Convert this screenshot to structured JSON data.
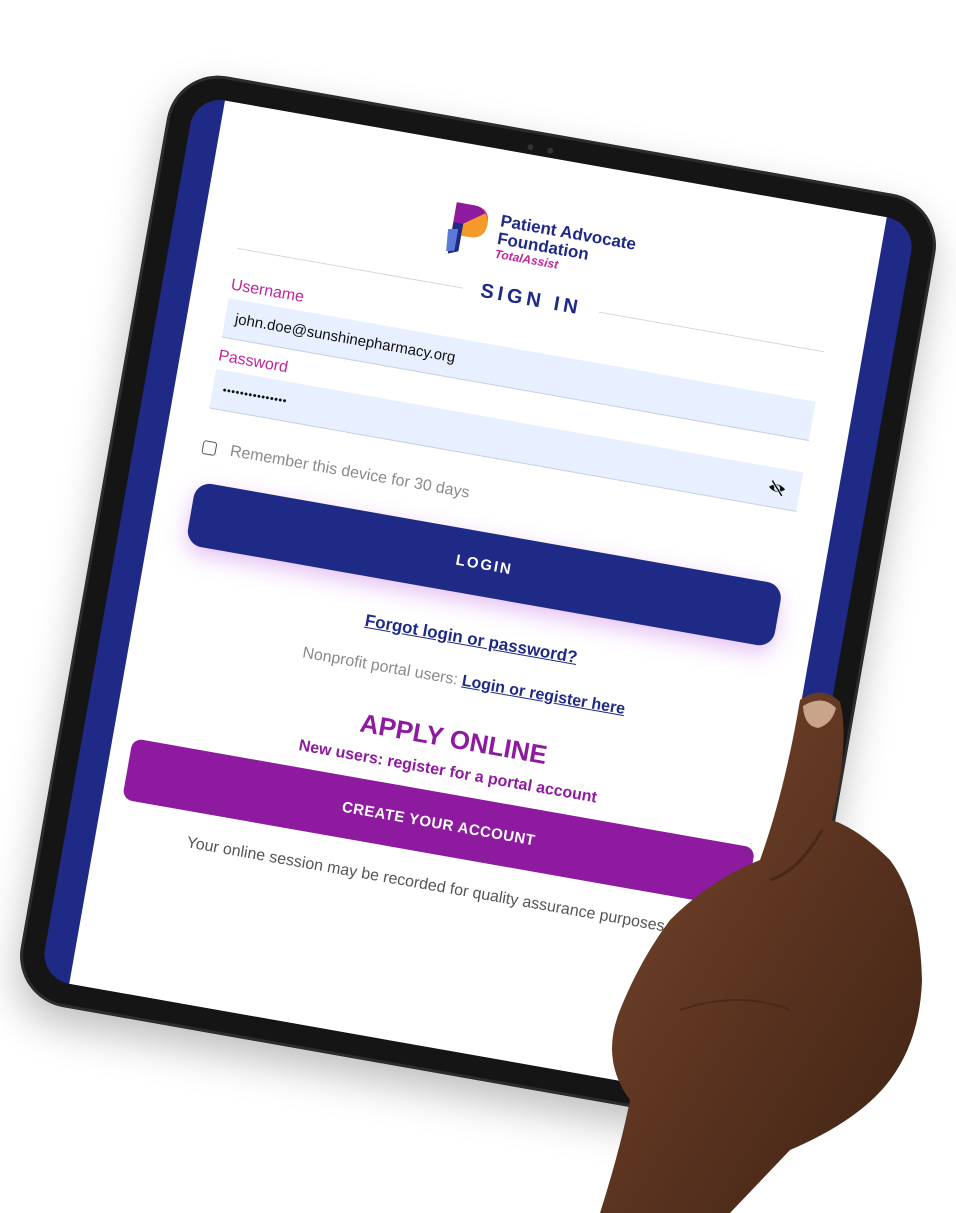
{
  "logo": {
    "name_line1": "Patient Advocate",
    "name_line2": "Foundation",
    "product": "TotalAssist",
    "colors": {
      "blue": "#1f2a86",
      "magenta": "#c0269c",
      "purple": "#8e1aa0"
    }
  },
  "signin": {
    "title": "SIGN IN"
  },
  "username": {
    "label": "Username",
    "value": "john.doe@sunshinepharmacy.org"
  },
  "password": {
    "label": "Password",
    "value": "•••••••••••••••",
    "toggle_icon": "eye-slash-icon"
  },
  "remember": {
    "label": "Remember this device for 30 days",
    "checked": false
  },
  "login_button": {
    "label": "LOGIN"
  },
  "forgot_link": {
    "label": "Forgot login or password?"
  },
  "nonprofit": {
    "text": "Nonprofit portal users: ",
    "link": "Login or register here"
  },
  "apply": {
    "title": "APPLY ONLINE",
    "subtitle": "New users: register for a portal account",
    "button": "CREATE YOUR ACCOUNT"
  },
  "session_note": "Your online session may be recorded for quality assurance purposes."
}
